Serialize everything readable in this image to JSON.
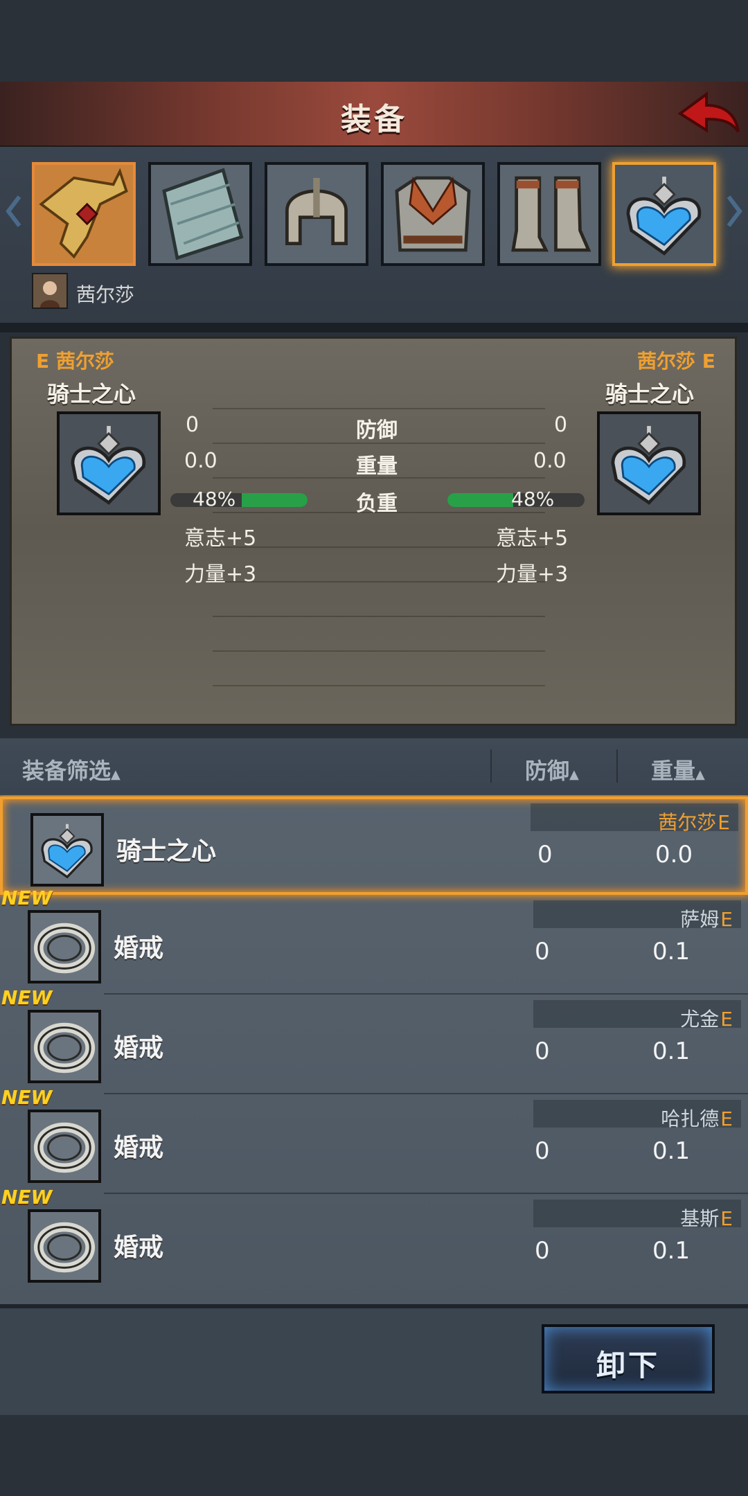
{
  "header": {
    "title": "装备"
  },
  "character": {
    "name": "茜尔莎"
  },
  "comparison": {
    "left": {
      "owner_mark": "E",
      "owner": "茜尔莎",
      "item_name": "骑士之心",
      "defense": "0",
      "weight": "0.0",
      "load_text": "48%",
      "load_value": 0.48,
      "bonuses": [
        "意志+5",
        "力量+3"
      ]
    },
    "right": {
      "owner": "茜尔莎",
      "owner_mark": "E",
      "item_name": "骑士之心",
      "defense": "0",
      "weight": "0.0",
      "load_text": "48%",
      "load_value": 0.48,
      "bonuses": [
        "意志+5",
        "力量+3"
      ]
    },
    "labels": {
      "defense": "防御",
      "weight": "重量",
      "load": "负重"
    }
  },
  "filter": {
    "filter_label": "装备筛选",
    "defense_label": "防御",
    "weight_label": "重量"
  },
  "items": [
    {
      "name": "骑士之心",
      "owner": "茜尔莎",
      "owner_mark": "E",
      "defense": "0",
      "weight": "0.0",
      "is_new": false,
      "selected": true,
      "icon": "heart-pendant-icon"
    },
    {
      "name": "婚戒",
      "owner": "萨姆",
      "owner_mark": "E",
      "defense": "0",
      "weight": "0.1",
      "is_new": true,
      "new_label": "NEW",
      "icon": "ring-icon"
    },
    {
      "name": "婚戒",
      "owner": "尤金",
      "owner_mark": "E",
      "defense": "0",
      "weight": "0.1",
      "is_new": true,
      "new_label": "NEW",
      "icon": "ring-icon"
    },
    {
      "name": "婚戒",
      "owner": "哈扎德",
      "owner_mark": "E",
      "defense": "0",
      "weight": "0.1",
      "is_new": true,
      "new_label": "NEW",
      "icon": "ring-icon"
    },
    {
      "name": "婚戒",
      "owner": "基斯",
      "owner_mark": "E",
      "defense": "0",
      "weight": "0.1",
      "is_new": true,
      "new_label": "NEW",
      "icon": "ring-icon"
    }
  ],
  "buttons": {
    "unequip_label": "卸下"
  },
  "colors": {
    "accent": "#f0a030",
    "header_red": "#9a4a3c",
    "load_green": "#28a048"
  }
}
